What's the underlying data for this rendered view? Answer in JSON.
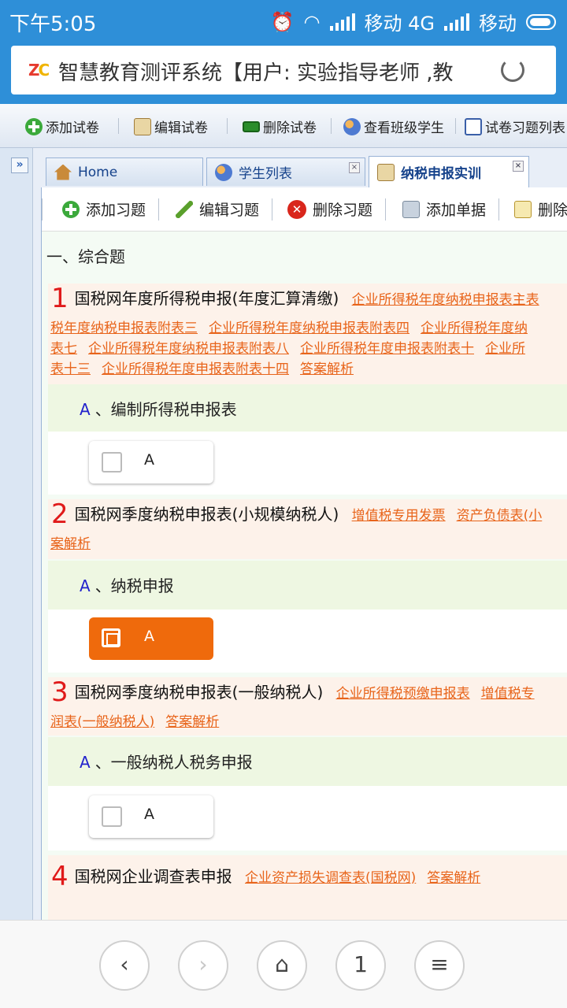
{
  "status": {
    "time": "下午5:05",
    "carrier1": "移动 4G",
    "carrier2": "移动"
  },
  "browser": {
    "logo": "ZC",
    "title": "智慧教育测评系统【用户: 实验指导老师 ,教"
  },
  "toolbar": {
    "items": [
      "添加试卷",
      "编辑试卷",
      "删除试卷",
      "查看班级学生",
      "试卷习题列表"
    ]
  },
  "tabs": [
    {
      "label": "Home"
    },
    {
      "label": "学生列表"
    },
    {
      "label": "纳税申报实训"
    }
  ],
  "subtoolbar": {
    "items": [
      "添加习题",
      "编辑习题",
      "删除习题",
      "添加单据",
      "删除"
    ]
  },
  "section_title": "一、综合题",
  "questions": [
    {
      "number": "1",
      "title": "国税网年度所得税申报(年度汇算清缴)",
      "links_line1": [
        "企业所得税年度纳税申报表主表"
      ],
      "links_line2": [
        "税年度纳税申报表附表三",
        "企业所得税年度纳税申报表附表四",
        "企业所得税年度纳"
      ],
      "links_line3": [
        "表七",
        "企业所得税年度纳税申报表附表八",
        "企业所得税年度申报表附表十",
        "企业所"
      ],
      "links_line4": [
        "表十三",
        "企业所得税年度申报表附表十四",
        "答案解析"
      ],
      "option_letter": "A",
      "option_text": "、编制所得税申报表",
      "choice": "A",
      "selected": false
    },
    {
      "number": "2",
      "title": "国税网季度纳税申报表(小规模纳税人)",
      "links_line1": [
        "增值税专用发票",
        "资产负债表(小"
      ],
      "links_line2": [
        "案解析"
      ],
      "option_letter": "A",
      "option_text": "、纳税申报",
      "choice": "A",
      "selected": true
    },
    {
      "number": "3",
      "title": "国税网季度纳税申报表(一般纳税人)",
      "links_line1": [
        "企业所得税预缴申报表",
        "增值税专"
      ],
      "links_line2": [
        "润表(一般纳税人)",
        "答案解析"
      ],
      "option_letter": "A",
      "option_text": "、一般纳税人税务申报",
      "choice": "A",
      "selected": false
    },
    {
      "number": "4",
      "title": "国税网企业调查表申报",
      "links_line1": [
        "企业资产损失调查表(国税网)",
        "答案解析"
      ]
    }
  ],
  "bottomnav": {
    "back": "‹",
    "forward": "›",
    "home": "⌂",
    "tabs": "1",
    "menu": "≡"
  }
}
